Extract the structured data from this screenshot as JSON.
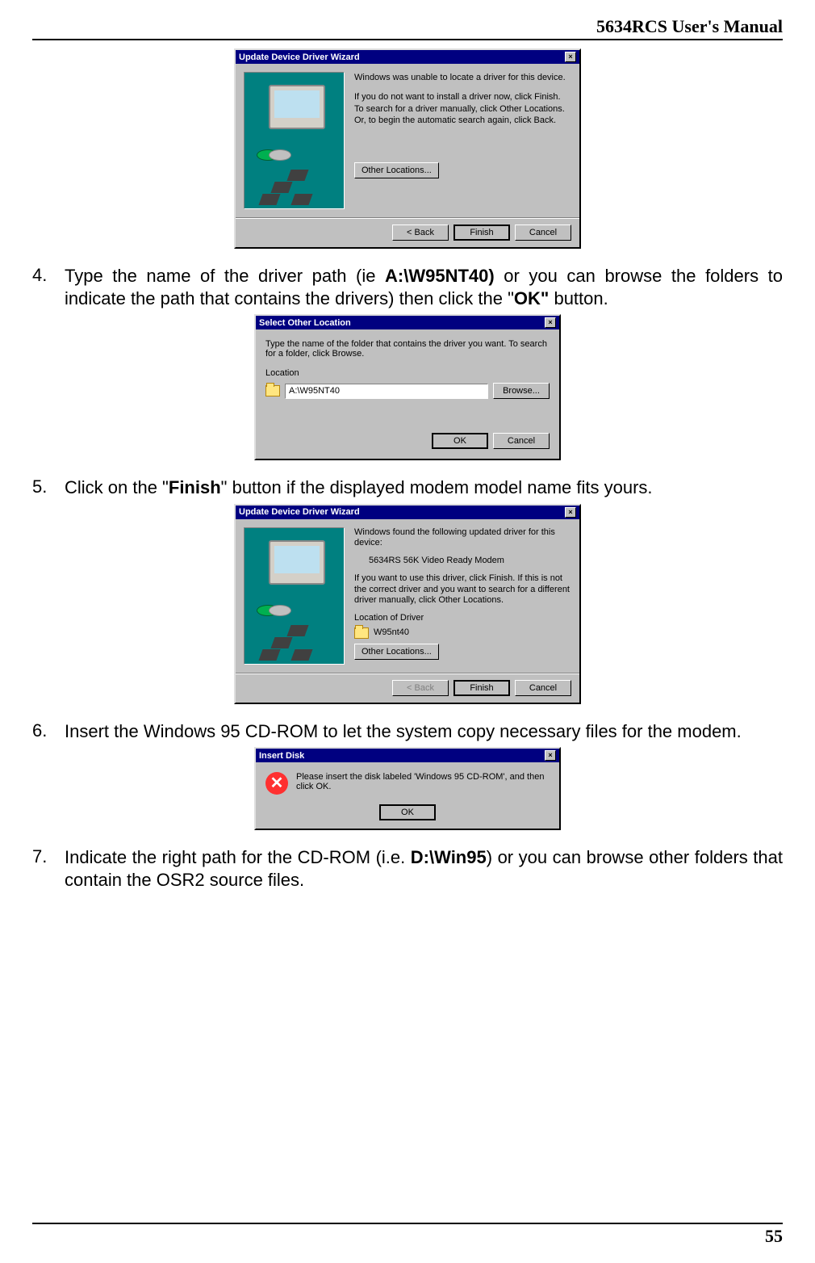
{
  "header": {
    "title": "5634RCS User's Manual"
  },
  "footer": {
    "page_number": "55"
  },
  "steps": {
    "s4": {
      "num": "4.",
      "pre": "Type the name of the driver path (ie ",
      "bold1": "A:\\W95NT40)",
      "mid": " or you can browse the folders to indicate the path that contains the drivers) then click the \"",
      "bold2": "OK\"",
      "post": " button."
    },
    "s5": {
      "num": "5.",
      "pre": "Click on the \"",
      "bold": "Finish",
      "post": "\" button if the displayed modem model name fits yours."
    },
    "s6": {
      "num": "6.",
      "text": "Insert the Windows 95 CD-ROM to let the system copy necessary files for the modem."
    },
    "s7": {
      "num": "7.",
      "pre": "Indicate the right path for the CD-ROM (i.e. ",
      "bold": "D:\\Win95",
      "post": ") or you can browse other folders that contain the OSR2 source files."
    }
  },
  "dlg1": {
    "title": "Update Device Driver Wizard",
    "p1": "Windows was unable to locate a driver for this device.",
    "p2": "If you do not want to install a driver now, click Finish. To search for a driver manually, click Other Locations. Or, to begin the automatic search again, click Back.",
    "other": "Other Locations...",
    "back": "< Back",
    "finish": "Finish",
    "cancel": "Cancel"
  },
  "dlg2": {
    "title": "Select Other Location",
    "desc": "Type the name of the folder that contains the driver you want. To search for a folder, click Browse.",
    "loc_label": "Location",
    "loc_value": "A:\\W95NT40",
    "browse": "Browse...",
    "ok": "OK",
    "cancel": "Cancel"
  },
  "dlg3": {
    "title": "Update Device Driver Wizard",
    "p1": "Windows found the following updated driver for this device:",
    "device": "5634RS 56K Video Ready Modem",
    "p2": "If you want to use this driver, click Finish. If this is not the correct driver and you want to search for a different driver manually, click Other Locations.",
    "loc_label": "Location of Driver",
    "loc_value": "W95nt40",
    "other": "Other Locations...",
    "back": "< Back",
    "finish": "Finish",
    "cancel": "Cancel"
  },
  "dlg4": {
    "title": "Insert Disk",
    "msg": "Please insert the disk labeled 'Windows 95 CD-ROM', and then click OK.",
    "ok": "OK"
  }
}
